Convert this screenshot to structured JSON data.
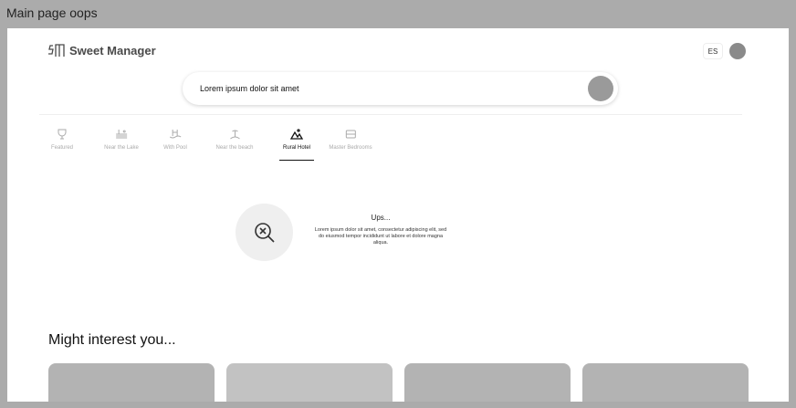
{
  "frame_title": "Main page oops",
  "header": {
    "logo_text": "Sweet Manager",
    "lang": "ES"
  },
  "search": {
    "value": "Lorem ipsum dolor sit amet"
  },
  "categories": [
    {
      "label": "Featured",
      "icon": "trophy-icon"
    },
    {
      "label": "Near the Lake",
      "icon": "lake-icon"
    },
    {
      "label": "With Pool",
      "icon": "pool-icon"
    },
    {
      "label": "Near the beach",
      "icon": "beach-icon"
    },
    {
      "label": "Rural Hotel",
      "icon": "mountain-icon",
      "active": true
    },
    {
      "label": "Master Bedrooms",
      "icon": "bed-icon"
    }
  ],
  "empty": {
    "title": "Ups...",
    "text": "Lorem ipsum dolor sit amet, consectetur adipiscing elit, sed do eiusmod tempor incididunt ut labore et dolore magna aliqua."
  },
  "recommend": {
    "title": "Might interest you..."
  }
}
